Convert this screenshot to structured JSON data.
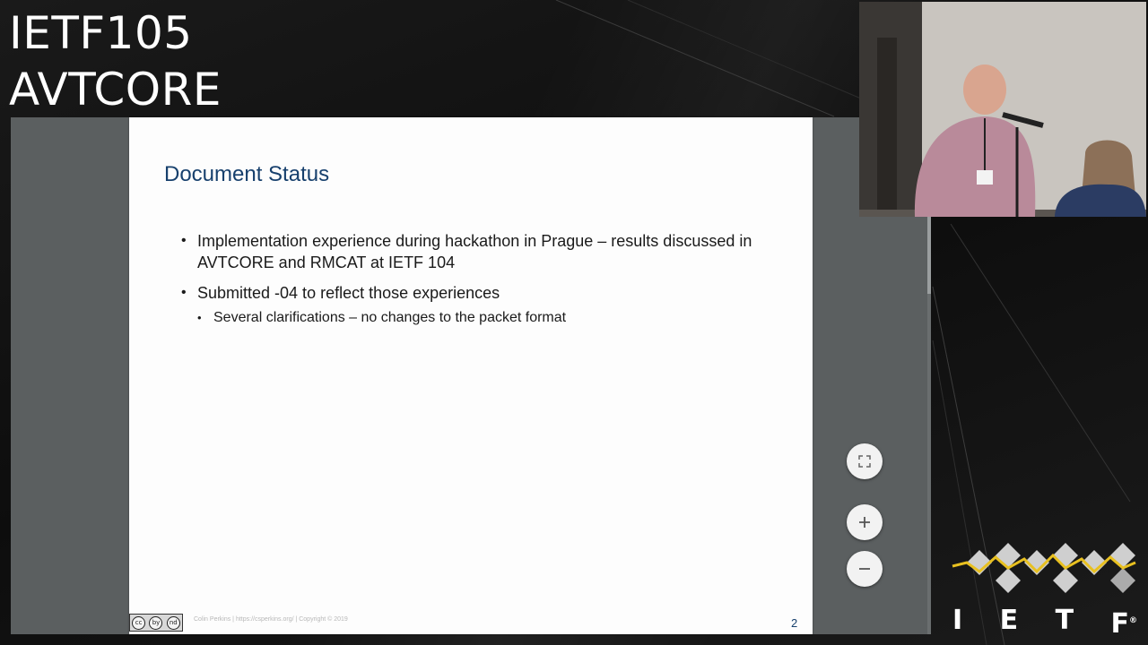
{
  "stream": {
    "title_line1": "IETF105",
    "title_line2": "AVTCORE"
  },
  "slide": {
    "title": "Document Status",
    "bullets": [
      {
        "text": "Implementation experience during hackathon in Prague – results discussed in AVTCORE and RMCAT at IETF 104"
      },
      {
        "text": "Submitted -04 to reflect those experiences",
        "sub": [
          "Several clarifications – no changes to the packet format"
        ]
      }
    ],
    "footer": "Colin Perkins | https://csperkins.org/ | Copyright © 2019",
    "page_number": "2",
    "license_badge": [
      "cc",
      "by",
      "nd"
    ]
  },
  "viewer": {
    "fullscreen_icon": "fullscreen-icon",
    "zoom_in_icon": "plus-icon",
    "zoom_out_icon": "minus-icon"
  },
  "logo": {
    "letters": [
      "I",
      "E",
      "T",
      "F"
    ],
    "registered": "®",
    "accent_color": "#e8c020",
    "diamond_color": "#cfcfcf"
  },
  "colors": {
    "slide_title": "#17406d",
    "viewer_bg": "#5b5f60",
    "background": "#111111"
  }
}
